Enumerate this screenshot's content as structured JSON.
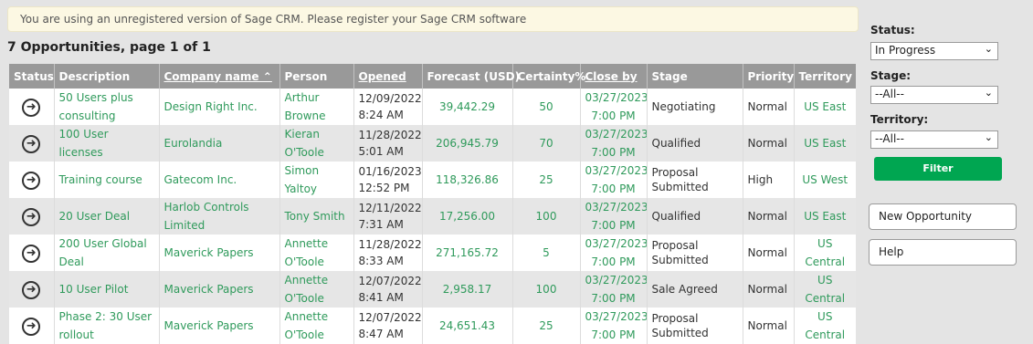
{
  "banner": {
    "text": "You are using an unregistered version of Sage CRM. Please register your Sage CRM software"
  },
  "heading": "7 Opportunities, page 1 of 1",
  "table": {
    "headers": {
      "status": "Status",
      "description": "Description",
      "company": "Company name ⌃",
      "person": "Person",
      "opened": "Opened",
      "forecast": "Forecast (USD)",
      "certainty": "Certainty%",
      "close_by": "Close by",
      "stage": "Stage",
      "priority": "Priority",
      "territory": "Territory"
    },
    "rows": [
      {
        "description": [
          "50 Users plus",
          "consulting"
        ],
        "company": [
          "Design Right Inc.",
          ""
        ],
        "person": [
          "Arthur",
          "Browne"
        ],
        "opened": [
          "12/09/2022",
          "8:24 AM"
        ],
        "forecast": "39,442.29",
        "certainty": "50",
        "close_by": [
          "03/27/2023",
          "7:00 PM"
        ],
        "stage": [
          "Negotiating",
          ""
        ],
        "priority": "Normal",
        "territory": [
          "US East",
          ""
        ]
      },
      {
        "description": [
          "100 User licenses",
          ""
        ],
        "company": [
          "Eurolandia",
          ""
        ],
        "person": [
          "Kieran",
          "O'Toole"
        ],
        "opened": [
          "11/28/2022",
          "5:01 AM"
        ],
        "forecast": "206,945.79",
        "certainty": "70",
        "close_by": [
          "03/27/2023",
          "7:00 PM"
        ],
        "stage": [
          "Qualified",
          ""
        ],
        "priority": "Normal",
        "territory": [
          "US East",
          ""
        ]
      },
      {
        "description": [
          "Training course",
          ""
        ],
        "company": [
          "Gatecom Inc.",
          ""
        ],
        "person": [
          "Simon",
          "Yaltoy"
        ],
        "opened": [
          "01/16/2023",
          "12:52 PM"
        ],
        "forecast": "118,326.86",
        "certainty": "25",
        "close_by": [
          "03/27/2023",
          "7:00 PM"
        ],
        "stage": [
          "Proposal",
          "Submitted"
        ],
        "priority": "High",
        "territory": [
          "US West",
          ""
        ]
      },
      {
        "description": [
          "20 User Deal",
          ""
        ],
        "company": [
          "Harlob Controls",
          "Limited"
        ],
        "person": [
          "Tony Smith",
          ""
        ],
        "opened": [
          "12/11/2022",
          "7:31 AM"
        ],
        "forecast": "17,256.00",
        "certainty": "100",
        "close_by": [
          "03/27/2023",
          "7:00 PM"
        ],
        "stage": [
          "Qualified",
          ""
        ],
        "priority": "Normal",
        "territory": [
          "US East",
          ""
        ]
      },
      {
        "description": [
          "200 User Global",
          "Deal"
        ],
        "company": [
          "Maverick Papers",
          ""
        ],
        "person": [
          "Annette",
          "O'Toole"
        ],
        "opened": [
          "11/28/2022",
          "8:33 AM"
        ],
        "forecast": "271,165.72",
        "certainty": "5",
        "close_by": [
          "03/27/2023",
          "7:00 PM"
        ],
        "stage": [
          "Proposal",
          "Submitted"
        ],
        "priority": "Normal",
        "territory": [
          "US",
          "Central"
        ]
      },
      {
        "description": [
          "10 User Pilot",
          ""
        ],
        "company": [
          "Maverick Papers",
          ""
        ],
        "person": [
          "Annette",
          "O'Toole"
        ],
        "opened": [
          "12/07/2022",
          "8:41 AM"
        ],
        "forecast": "2,958.17",
        "certainty": "100",
        "close_by": [
          "03/27/2023",
          "7:00 PM"
        ],
        "stage": [
          "Sale Agreed",
          ""
        ],
        "priority": "Normal",
        "territory": [
          "US",
          "Central"
        ]
      },
      {
        "description": [
          "Phase 2: 30 User",
          "rollout"
        ],
        "company": [
          "Maverick Papers",
          ""
        ],
        "person": [
          "Annette",
          "O'Toole"
        ],
        "opened": [
          "12/07/2022",
          "8:47 AM"
        ],
        "forecast": "24,651.43",
        "certainty": "25",
        "close_by": [
          "03/27/2023",
          "7:00 PM"
        ],
        "stage": [
          "Proposal",
          "Submitted"
        ],
        "priority": "Normal",
        "territory": [
          "US",
          "Central"
        ]
      }
    ],
    "status_icon": "arrow-circle-right-icon"
  },
  "sidebar": {
    "status_label": "Status:",
    "status_value": "In Progress",
    "stage_label": "Stage:",
    "stage_value": "--All--",
    "territory_label": "Territory:",
    "territory_value": "--All--",
    "filter_label": "Filter",
    "new_opportunity_label": "New Opportunity",
    "help_label": "Help"
  },
  "colors": {
    "link_green": "#2f9a5b",
    "header_gray": "#999999",
    "filter_green": "#00a651",
    "banner_bg": "#fcf8e3"
  }
}
